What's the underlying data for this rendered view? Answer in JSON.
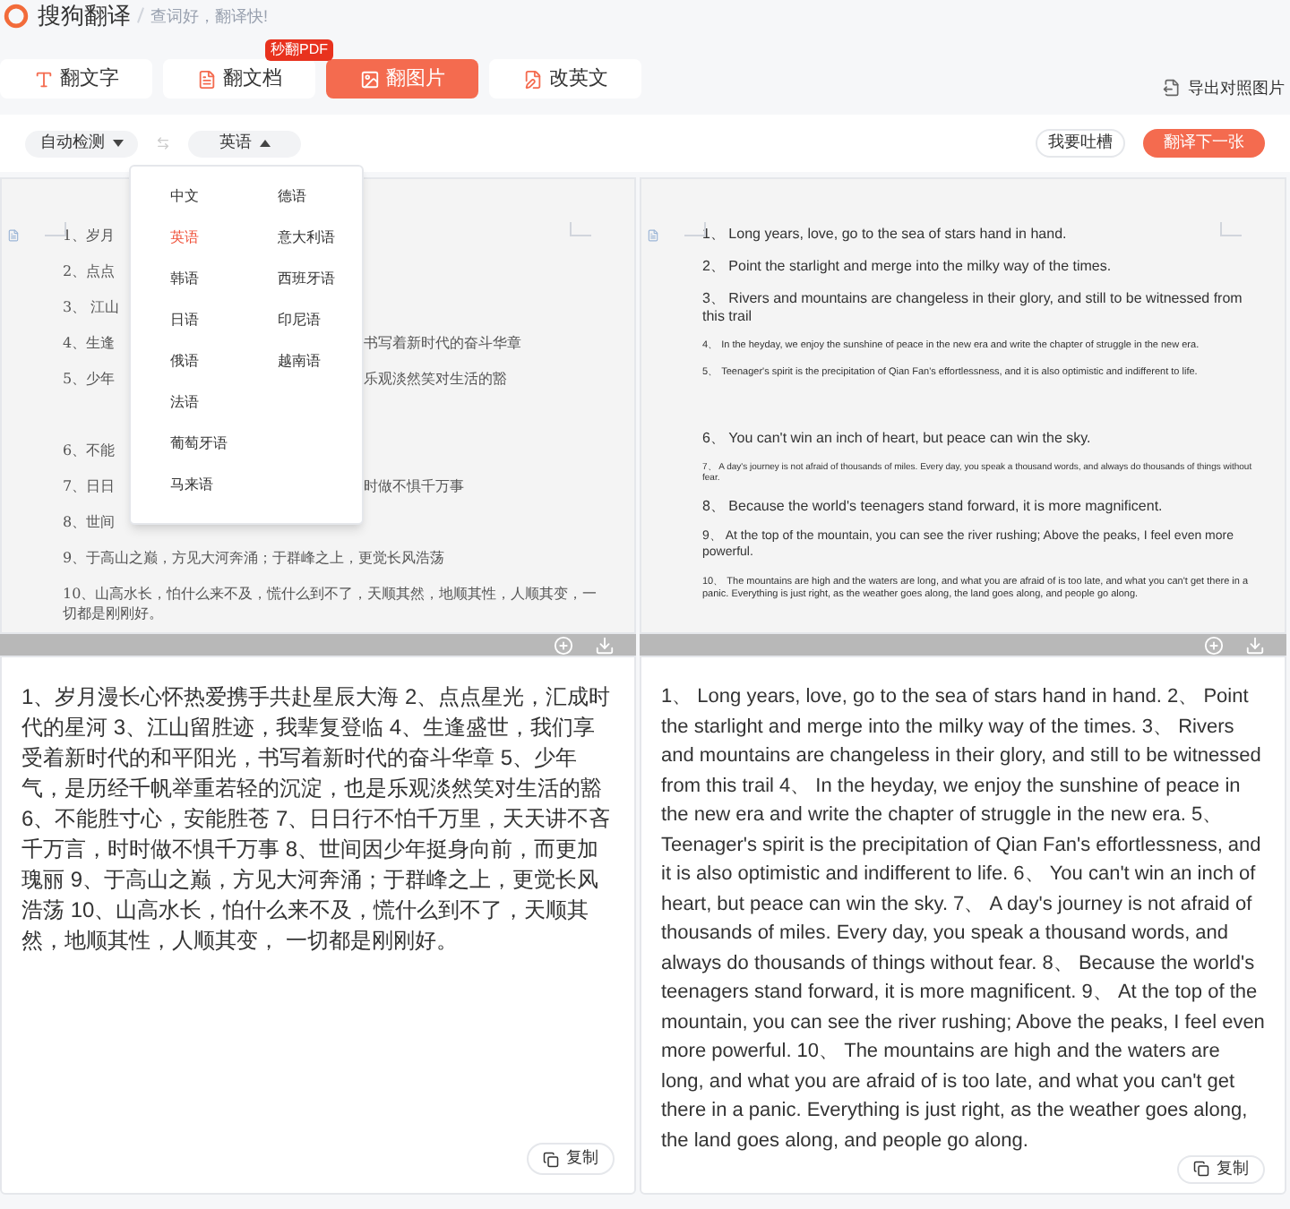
{
  "header": {
    "logo_text": "搜狗翻译",
    "slogan": "查词好，翻译快!"
  },
  "tabs": [
    {
      "label": "翻文字",
      "kind": "text",
      "selected": false
    },
    {
      "label": "翻文档",
      "kind": "document",
      "selected": false,
      "badge": "秒翻PDF"
    },
    {
      "label": "翻图片",
      "kind": "image",
      "selected": true
    },
    {
      "label": "改英文",
      "kind": "edit",
      "selected": false
    }
  ],
  "export_button": "导出对照图片",
  "toolbar": {
    "source_language": "自动检测",
    "target_language": "英语",
    "target_expanded": true,
    "feedback_button": "我要吐槽",
    "next_button": "翻译下一张"
  },
  "language_menu": {
    "columns": [
      [
        {
          "label": "中文",
          "selected": false
        },
        {
          "label": "英语",
          "selected": true
        },
        {
          "label": "韩语",
          "selected": false
        },
        {
          "label": "日语",
          "selected": false
        },
        {
          "label": "俄语",
          "selected": false
        },
        {
          "label": "法语",
          "selected": false
        },
        {
          "label": "葡萄牙语",
          "selected": false
        },
        {
          "label": "马来语",
          "selected": false
        }
      ],
      [
        {
          "label": "德语",
          "selected": false
        },
        {
          "label": "意大利语",
          "selected": false
        },
        {
          "label": "西班牙语",
          "selected": false
        },
        {
          "label": "印尼语",
          "selected": false
        },
        {
          "label": "越南语",
          "selected": false
        }
      ]
    ]
  },
  "source_image": {
    "lines": [
      {
        "start": "1、岁月"
      },
      {
        "start": "2、点点"
      },
      {
        "start": "3、 江山"
      },
      {
        "start": "4、生逢",
        "end": "书写着新时代的奋斗华章"
      },
      {
        "start": "5、少年",
        "end": "乐观淡然笑对生活的豁",
        "gap_after": true
      },
      {
        "start": "6、不能"
      },
      {
        "start": "7、日日",
        "end": "时做不惧千万事"
      },
      {
        "start": "8、世间"
      },
      {
        "start": "9、于高山之巅，方见大河奔涌；于群峰之上，更觉长风浩荡"
      },
      {
        "start": "10、山高水长，怕什么来不及，慌什么到不了，天顺其然，地顺其性，人顺其变，一切都是刚刚好。"
      }
    ]
  },
  "translated_image": {
    "lines": [
      {
        "kind": "large",
        "text": "1、 Long years, love, go to the sea of stars hand in hand."
      },
      {
        "kind": "large",
        "text": "2、 Point the starlight and merge into the milky way of the times."
      },
      {
        "kind": "large",
        "text": "3、 Rivers and mountains are changeless in their glory, and still to be witnessed from this trail"
      },
      {
        "kind": "small",
        "text": "4、 In the heyday, we enjoy the sunshine of peace in the new era and write the chapter of struggle in the new era."
      },
      {
        "kind": "small",
        "text": "5、 Teenager's spirit is the precipitation of Qian Fan's effortlessness, and it is also optimistic and indifferent to life.",
        "gap_after": true
      },
      {
        "kind": "large",
        "text": "6、 You can't win an inch of heart, but peace can win the sky."
      },
      {
        "kind": "tiny",
        "text": "7、 A day's journey is not afraid of thousands of miles. Every day, you speak a thousand words, and always do thousands of things without fear."
      },
      {
        "kind": "large",
        "text": "8、 Because the world's teenagers stand forward, it is more magnificent."
      },
      {
        "kind": "medium",
        "text": "9、 At the top of the mountain, you can see the river rushing; Above the peaks, I feel even more powerful."
      },
      {
        "kind": "small",
        "text": "10、 The mountains are high and the waters are long, and what you are afraid of is too late, and what you can't get there in a panic. Everything is just right, as the weather goes along, the land goes along, and people go along."
      }
    ]
  },
  "source_text": {
    "text": "1、岁月漫长心怀热爱携手共赴星辰大海 2、点点星光，汇成时代的星河 3、江山留胜迹，我辈复登临 4、生逢盛世，我们享受着新时代的和平阳光，书写着新时代的奋斗华章 5、少年气，是历经千帆举重若轻的沉淀，也是乐观淡然笑对生活的豁 6、不能胜寸心，安能胜苍 7、日日行不怕千万里，天天讲不吝千万言，时时做不惧千万事 8、世间因少年挺身向前，而更加瑰丽 9、于高山之巅，方见大河奔涌；于群峰之上，更觉长风浩荡 10、山高水长，怕什么来不及，慌什么到不了，天顺其然，地顺其性，人顺其变， 一切都是刚刚好。",
    "copy_button": "复制"
  },
  "translated_text": {
    "text": "1、 Long years, love, go to the sea of stars hand in hand. 2、 Point the starlight and merge into the milky way of the times. 3、 Rivers and mountains are changeless in their glory, and still to be witnessed from this trail 4、 In the heyday, we enjoy the sunshine of peace in the new era and write the chapter of struggle in the new era. 5、 Teenager's spirit is the precipitation of Qian Fan's effortlessness, and it is also optimistic and indifferent to life. 6、 You can't win an inch of heart, but peace can win the sky. 7、 A day's journey is not afraid of thousands of miles. Every day, you speak a thousand words, and always do thousands of things without fear. 8、 Because the world's teenagers stand forward, it is more magnificent. 9、 At the top of the mountain, you can see the river rushing; Above the peaks, I feel even more powerful. 10、 The mountains are high and the waters are long, and what you are afraid of is too late, and what you can't get there in a panic. Everything is just right, as the weather goes along, the land goes along, and people go along.",
    "copy_button": "复制"
  }
}
